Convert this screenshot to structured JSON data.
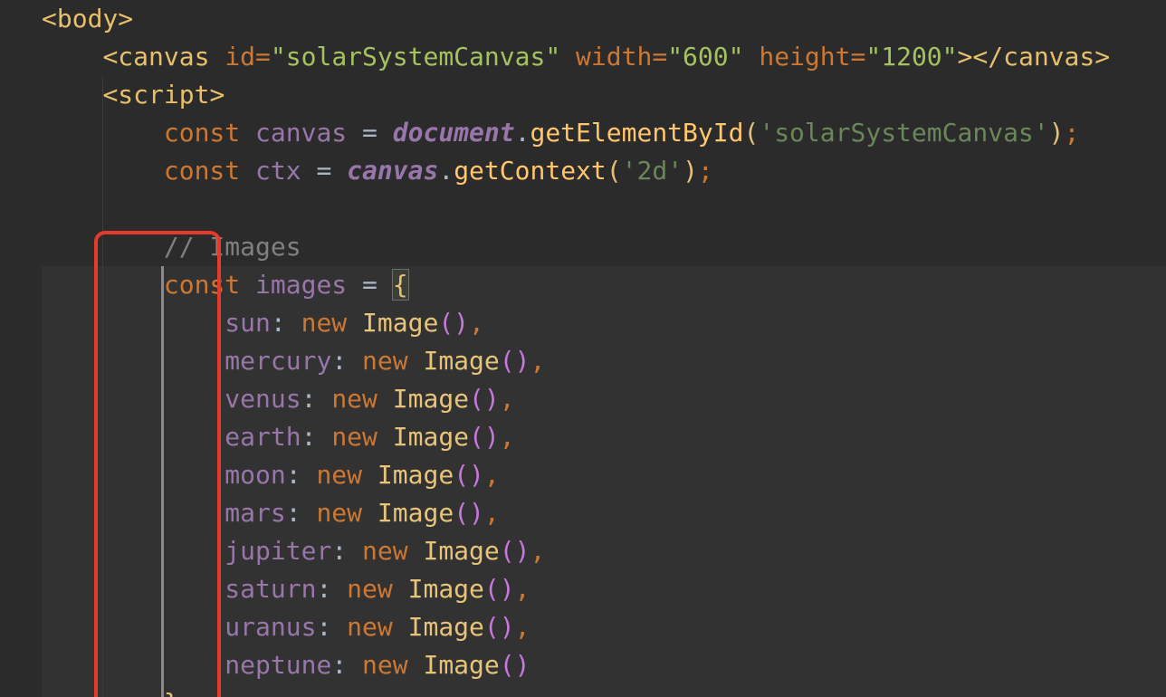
{
  "editor": {
    "lines": {
      "l1": {
        "tag": "<body>"
      },
      "l2": {
        "open": "<canvas",
        "id_attr": "id=",
        "id_val": "\"solarSystemCanvas\"",
        "w_attr": "width=",
        "w_val": "\"600\"",
        "h_attr": "height=",
        "h_val": "\"1200\"",
        "close": "></canvas>"
      },
      "l3": {
        "tag": "<script>"
      },
      "l4": {
        "kw": "const",
        "var": "canvas",
        "eq": "=",
        "obj": "document",
        "dot": ".",
        "method": "getElementById",
        "lp": "(",
        "arg": "'solarSystemCanvas'",
        "rp": ")",
        "semi": ";"
      },
      "l5": {
        "kw": "const",
        "var": "ctx",
        "eq": "=",
        "obj": "canvas",
        "dot": ".",
        "method": "getContext",
        "lp": "(",
        "arg": "'2d'",
        "rp": ")",
        "semi": ";"
      },
      "l7": {
        "comment": "// Images"
      },
      "l8": {
        "kw": "const",
        "var": "images",
        "eq": "=",
        "brace": "{"
      },
      "entries": [
        {
          "key": "sun",
          "colon": ":",
          "kw": "new",
          "cls": "Image",
          "parens": "()",
          "comma": ","
        },
        {
          "key": "mercury",
          "colon": ":",
          "kw": "new",
          "cls": "Image",
          "parens": "()",
          "comma": ","
        },
        {
          "key": "venus",
          "colon": ":",
          "kw": "new",
          "cls": "Image",
          "parens": "()",
          "comma": ","
        },
        {
          "key": "earth",
          "colon": ":",
          "kw": "new",
          "cls": "Image",
          "parens": "()",
          "comma": ","
        },
        {
          "key": "moon",
          "colon": ":",
          "kw": "new",
          "cls": "Image",
          "parens": "()",
          "comma": ","
        },
        {
          "key": "mars",
          "colon": ":",
          "kw": "new",
          "cls": "Image",
          "parens": "()",
          "comma": ","
        },
        {
          "key": "jupiter",
          "colon": ":",
          "kw": "new",
          "cls": "Image",
          "parens": "()",
          "comma": ","
        },
        {
          "key": "saturn",
          "colon": ":",
          "kw": "new",
          "cls": "Image",
          "parens": "()",
          "comma": ","
        },
        {
          "key": "uranus",
          "colon": ":",
          "kw": "new",
          "cls": "Image",
          "parens": "()",
          "comma": ","
        },
        {
          "key": "neptune",
          "colon": ":",
          "kw": "new",
          "cls": "Image",
          "parens": "()",
          "comma": ""
        }
      ],
      "l19": {
        "brace": "}"
      }
    }
  },
  "colors": {
    "background": "#2b2b2b",
    "highlight_box": "#e53b2c",
    "keyword": "#cc7832",
    "string": "#6a8759",
    "property": "#9876aa",
    "method": "#ffc66d",
    "comment": "#808080"
  }
}
